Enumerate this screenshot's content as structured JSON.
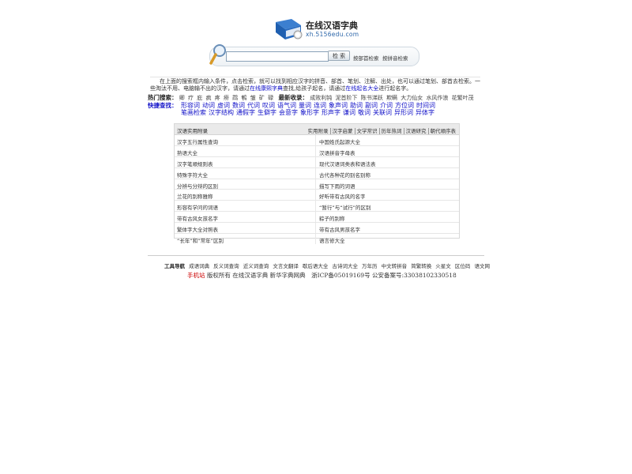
{
  "header": {
    "title": "在线汉语字典",
    "domain": "xh.5156edu.com"
  },
  "search": {
    "value": "",
    "button_label": "检 索",
    "options": [
      "按部首检索",
      "按拼音检索"
    ]
  },
  "description": "在上面的搜索框内输入条件，点击检索，就可以找到相应汉字的拼音、部首、笔划、注解、出处，也可以通过笔划、部首去检索。一些淘汰不用、电脑输不出的汉字，请通过",
  "description_link1": "在线康熙字典",
  "description_mid": "查找,给孩子起名，请通过",
  "description_link2": "在线起名大全",
  "description_end": "进行起名字。",
  "hot": {
    "label": "热门搜索：",
    "words": [
      "卿",
      "疗",
      "庇",
      "疯",
      "疼",
      "痨",
      "鹉",
      "鹌",
      "皱",
      "矿",
      "碌"
    ],
    "recent_label": "最新收录：",
    "recent": [
      "成败利钝",
      "泥首阶下",
      "陈书涕跃",
      "欺瞒",
      "大力仙女",
      "水风作浪",
      "花繁叶茂"
    ]
  },
  "quick": {
    "label": "快捷查找：",
    "line1": [
      "形容词",
      "动词",
      "虚词",
      "数词",
      "代词",
      "叹词",
      "语气词",
      "量词",
      "连词",
      "象声词",
      "助词",
      "副词",
      "介词",
      "方位词",
      "时间词"
    ],
    "line2": [
      "笔画检索",
      "汉字结构",
      "通假字",
      "生僻字",
      "会意字",
      "象形字",
      "形声字",
      "谦词",
      "敬词",
      "关联词",
      "异形词",
      "异体字"
    ]
  },
  "panel": {
    "title": "汉语实用附录",
    "tabs": [
      "实用附录",
      "汉字启蒙",
      "文学常识",
      "历年热词",
      "汉语研究",
      "朝代顺序表"
    ],
    "rows": [
      [
        "汉字五行属性查询",
        "中国姓氏起源大全"
      ],
      [
        "熟语大全",
        "汉语拼音字母表"
      ],
      [
        "汉字笔顺规则表",
        "现代汉语词类表和语法表"
      ],
      [
        "特殊字符大全",
        "古代各种花的别名别称"
      ],
      [
        "分辨与分辩的区别",
        "描写下雨的词语"
      ],
      [
        "兰花的别称雅称",
        "好听带有古风的名字"
      ],
      [
        "形容有学问的词语",
        "“暂行”与“试行”的区别"
      ],
      [
        "带有古风女孩名字",
        "粽子的别称"
      ],
      [
        "繁体字大全对照表",
        "带有古风男孩名字"
      ],
      [
        "“长年”和“常年”区别",
        "语言修大全"
      ]
    ]
  },
  "footer": {
    "tools_label": "工具导航",
    "tools": [
      "成语词典",
      "反义词查询",
      "近义词查询",
      "文言文翻译",
      "歇后语大全",
      "古诗词大全",
      "万年历",
      "中文转拼音",
      "简繁转换",
      "火星文",
      "区位码",
      "语文网"
    ],
    "mobile": "手机站",
    "copyright": "版权所有 在线汉语字典 新华字典网典　浙ICP备05019169号 公安备案号:33038102330518"
  }
}
